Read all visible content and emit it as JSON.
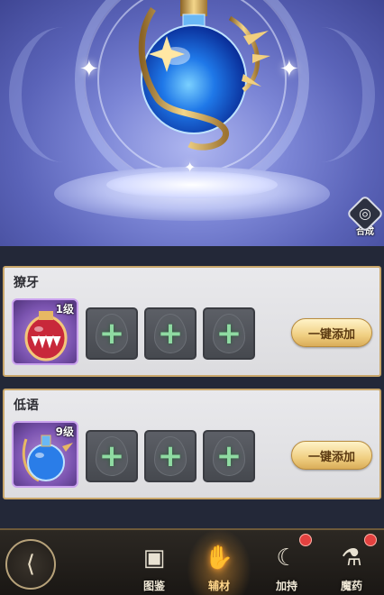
{
  "synthesis": {
    "label": "合成",
    "icon": "swirl-icon"
  },
  "panels": [
    {
      "title": "獠牙",
      "item": {
        "level": "1级",
        "icon": "fang-jar-icon"
      },
      "empty_slots": [
        "+",
        "+",
        "+"
      ],
      "add_all_label": "一键添加"
    },
    {
      "title": "低语",
      "item": {
        "level": "9级",
        "icon": "blue-potion-icon"
      },
      "empty_slots": [
        "+",
        "+",
        "+"
      ],
      "add_all_label": "一键添加"
    }
  ],
  "nav": {
    "back_icon": "back-arrow-icon",
    "items": [
      {
        "label": "图鉴",
        "icon": "book-icon",
        "active": false,
        "badge": false
      },
      {
        "label": "辅材",
        "icon": "hand-plus-icon",
        "active": true,
        "badge": false
      },
      {
        "label": "加持",
        "icon": "moon-icon",
        "active": false,
        "badge": true
      },
      {
        "label": "魔药",
        "icon": "potion-icon",
        "active": false,
        "badge": true
      }
    ]
  },
  "colors": {
    "panel_border": "#c9a66a",
    "plus": "#8fdba2",
    "badge": "#e3413f",
    "active_nav": "#ffd98a"
  }
}
